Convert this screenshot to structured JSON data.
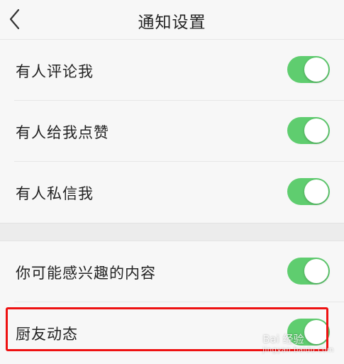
{
  "header": {
    "title": "通知设置",
    "back_icon": "chevron-left-icon"
  },
  "settings": {
    "group1": [
      {
        "label": "有人评论我",
        "enabled": true
      },
      {
        "label": "有人给我点赞",
        "enabled": true
      },
      {
        "label": "有人私信我",
        "enabled": true
      }
    ],
    "group2": [
      {
        "label": "你可能感兴趣的内容",
        "enabled": true
      },
      {
        "label": "厨友动态",
        "enabled": true
      }
    ]
  },
  "annotation": {
    "highlighted_item": "厨友动态",
    "color": "#ee1111"
  },
  "colors": {
    "toggle_on": "#5fcd6f",
    "background": "#f7f7f7"
  },
  "watermark": {
    "text": "Bai 经验",
    "sub": "jingyan.baidu.com"
  }
}
